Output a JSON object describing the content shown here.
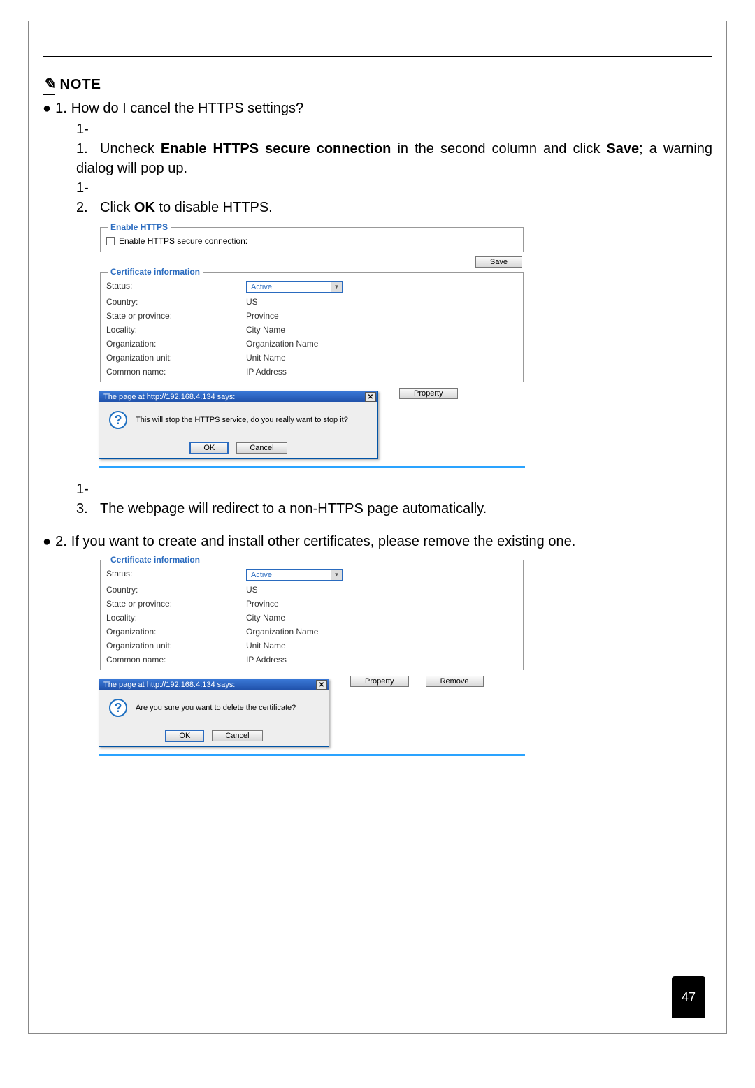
{
  "note_label": "NOTE",
  "q1": {
    "bullet": "●",
    "num": "1.",
    "question": "How do I cancel the HTTPS settings?",
    "step1_num": "1-1.",
    "step1_pre": "Uncheck ",
    "step1_bold": "Enable HTTPS secure connection",
    "step1_mid": " in the second column and click ",
    "step1_bold2": "Save",
    "step1_post": "; a warning dialog will pop up.",
    "step2_num": "1-2.",
    "step2_pre": "Click ",
    "step2_bold": "OK",
    "step2_post": " to disable HTTPS.",
    "step3_num": "1-3.",
    "step3_text": "The webpage will redirect to a non-HTTPS page automatically."
  },
  "q2": {
    "bullet": "●",
    "num": "2.",
    "text": "If you want to create and install other certificates, please remove the existing one."
  },
  "shot1": {
    "enable_https_legend": "Enable HTTPS",
    "enable_checkbox_label": "Enable HTTPS secure connection:",
    "save_btn": "Save",
    "cert_legend": "Certificate information",
    "labels": {
      "status": "Status:",
      "country": "Country:",
      "state": "State or province:",
      "locality": "Locality:",
      "org": "Organization:",
      "orgunit": "Organization unit:",
      "common": "Common name:"
    },
    "values": {
      "status": "Active",
      "country": "US",
      "state": "Province",
      "locality": "City Name",
      "org": "Organization Name",
      "orgunit": "Unit Name",
      "common": "IP Address"
    },
    "property_btn": "Property",
    "dialog": {
      "title": "The page at http://192.168.4.134 says:",
      "message": "This will stop the HTTPS service, do you really want to stop it?",
      "ok": "OK",
      "cancel": "Cancel"
    }
  },
  "shot2": {
    "cert_legend": "Certificate information",
    "labels": {
      "status": "Status:",
      "country": "Country:",
      "state": "State or province:",
      "locality": "Locality:",
      "org": "Organization:",
      "orgunit": "Organization unit:",
      "common": "Common name:"
    },
    "values": {
      "status": "Active",
      "country": "US",
      "state": "Province",
      "locality": "City Name",
      "org": "Organization Name",
      "orgunit": "Unit Name",
      "common": "IP Address"
    },
    "property_btn": "Property",
    "remove_btn": "Remove",
    "dialog": {
      "title": "The page at http://192.168.4.134 says:",
      "message": "Are you sure you want to delete the certificate?",
      "ok": "OK",
      "cancel": "Cancel"
    }
  },
  "page_number": "47"
}
